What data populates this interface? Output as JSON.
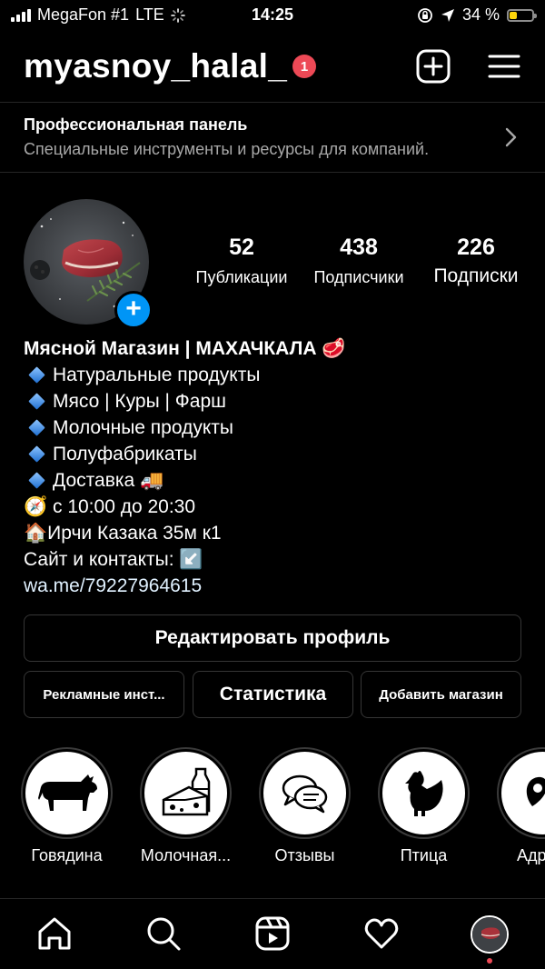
{
  "status_bar": {
    "carrier": "MegaFon #1",
    "network": "LTE",
    "time": "14:25",
    "battery_percent": "34 %",
    "battery_level": 0.34,
    "battery_color": "#ffd60a"
  },
  "header": {
    "username": "myasnoy_halal_",
    "notification_count": "1",
    "notification_color": "#ed4956"
  },
  "pro_panel": {
    "title": "Профессиональная панель",
    "subtitle": "Специальные инструменты и ресурсы для компаний."
  },
  "profile": {
    "stats": [
      {
        "value": "52",
        "label": "Публикации"
      },
      {
        "value": "438",
        "label": "Подписчики"
      },
      {
        "value": "226",
        "label": "Подписки"
      }
    ],
    "bio": {
      "name": "Мясной Магазин | МАХАЧКАЛА 🥩",
      "lines": [
        "Натуральные продукты",
        "Мясо | Куры | Фарш",
        "Молочные продукты",
        "Полуфабрикаты",
        "Доставка 🚚"
      ],
      "hours": "🧭 с 10:00 до 20:30",
      "address": "🏠Ирчи Казака 35м к1",
      "contacts": "Сайт и контакты: ↙️",
      "link": "wa.me/79227964615"
    }
  },
  "buttons": {
    "edit_profile": "Редактировать профиль",
    "ad_tools": "Рекламные инст...",
    "statistics": "Статистика",
    "add_shop": "Добавить магазин"
  },
  "highlights": [
    {
      "label": "Говядина",
      "icon": "cow-icon"
    },
    {
      "label": "Молочная...",
      "icon": "milk-cheese-icon"
    },
    {
      "label": "Отзывы",
      "icon": "chat-bubbles-icon"
    },
    {
      "label": "Птица",
      "icon": "chicken-icon"
    },
    {
      "label": "Адр",
      "icon": "location-icon"
    }
  ],
  "tab_bar": {
    "tabs": [
      "home-icon",
      "search-icon",
      "reels-icon",
      "heart-icon",
      "profile-avatar"
    ]
  },
  "colors": {
    "background": "#000000",
    "accent": "#0095f6",
    "link": "#e0f1ff"
  }
}
